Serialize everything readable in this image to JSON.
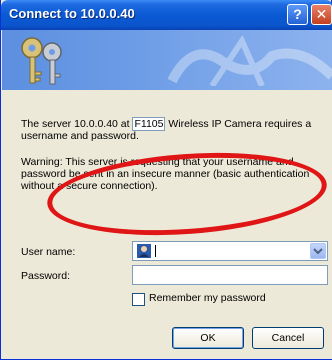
{
  "window": {
    "title": "Connect to 10.0.0.40",
    "help_glyph": "?",
    "close_glyph": "✕"
  },
  "message": {
    "p1_before": "The server 10.0.0.40 at ",
    "p1_realm": "F1105",
    "p1_after": " Wireless IP Camera requires a username and password.",
    "p2": "Warning: This server is requesting that your username and password be sent in an insecure manner (basic authentication without a secure connection)."
  },
  "form": {
    "username_label": "User name:",
    "username_value": "",
    "password_label": "Password:",
    "password_value": "",
    "remember_label": "Remember my password",
    "remember_checked": false
  },
  "buttons": {
    "ok": "OK",
    "cancel": "Cancel"
  },
  "icons": {
    "banner": "keys-icon",
    "user": "user-icon",
    "dropdown": "chevron-down-icon"
  },
  "colors": {
    "titlebar": "#0a5ad4",
    "annotation": "#e01515"
  }
}
